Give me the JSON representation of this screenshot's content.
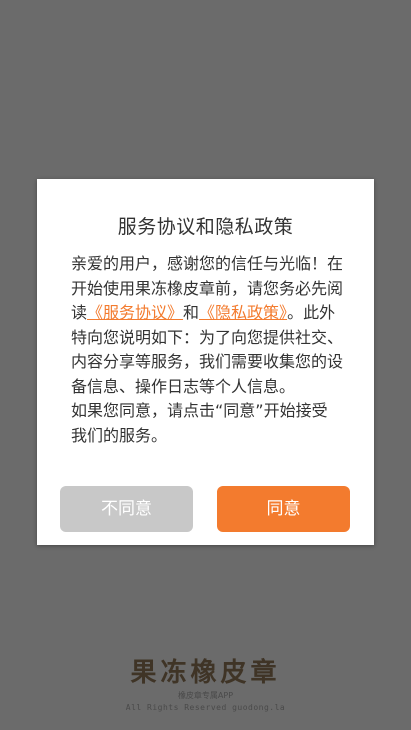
{
  "dialog": {
    "title": "服务协议和隐私政策",
    "body": {
      "greeting": "亲爱的用户，感谢您的信任与光临！在开始使用果冻橡皮章前，请您务必先阅读",
      "link_service": "《服务协议》",
      "and": "和",
      "link_privacy": "《隐私政策》",
      "after_links": "。此外特向您说明如下：为了向您提供社交、内容分享等服务，我们需要收集您的设备信息、操作日志等个人信息。",
      "consent": "如果您同意，请点击“同意”开始接受我们的服务。"
    },
    "disagree_label": "不同意",
    "agree_label": "同意"
  },
  "footer": {
    "brand": "果冻橡皮章",
    "subtitle": "橡皮章专属APP",
    "copyright": "All Rights Reserved guodong.la"
  },
  "colors": {
    "overlay": "#6b6b6b",
    "accent": "#f37b2e",
    "disabled_button": "#c8c8c8"
  }
}
